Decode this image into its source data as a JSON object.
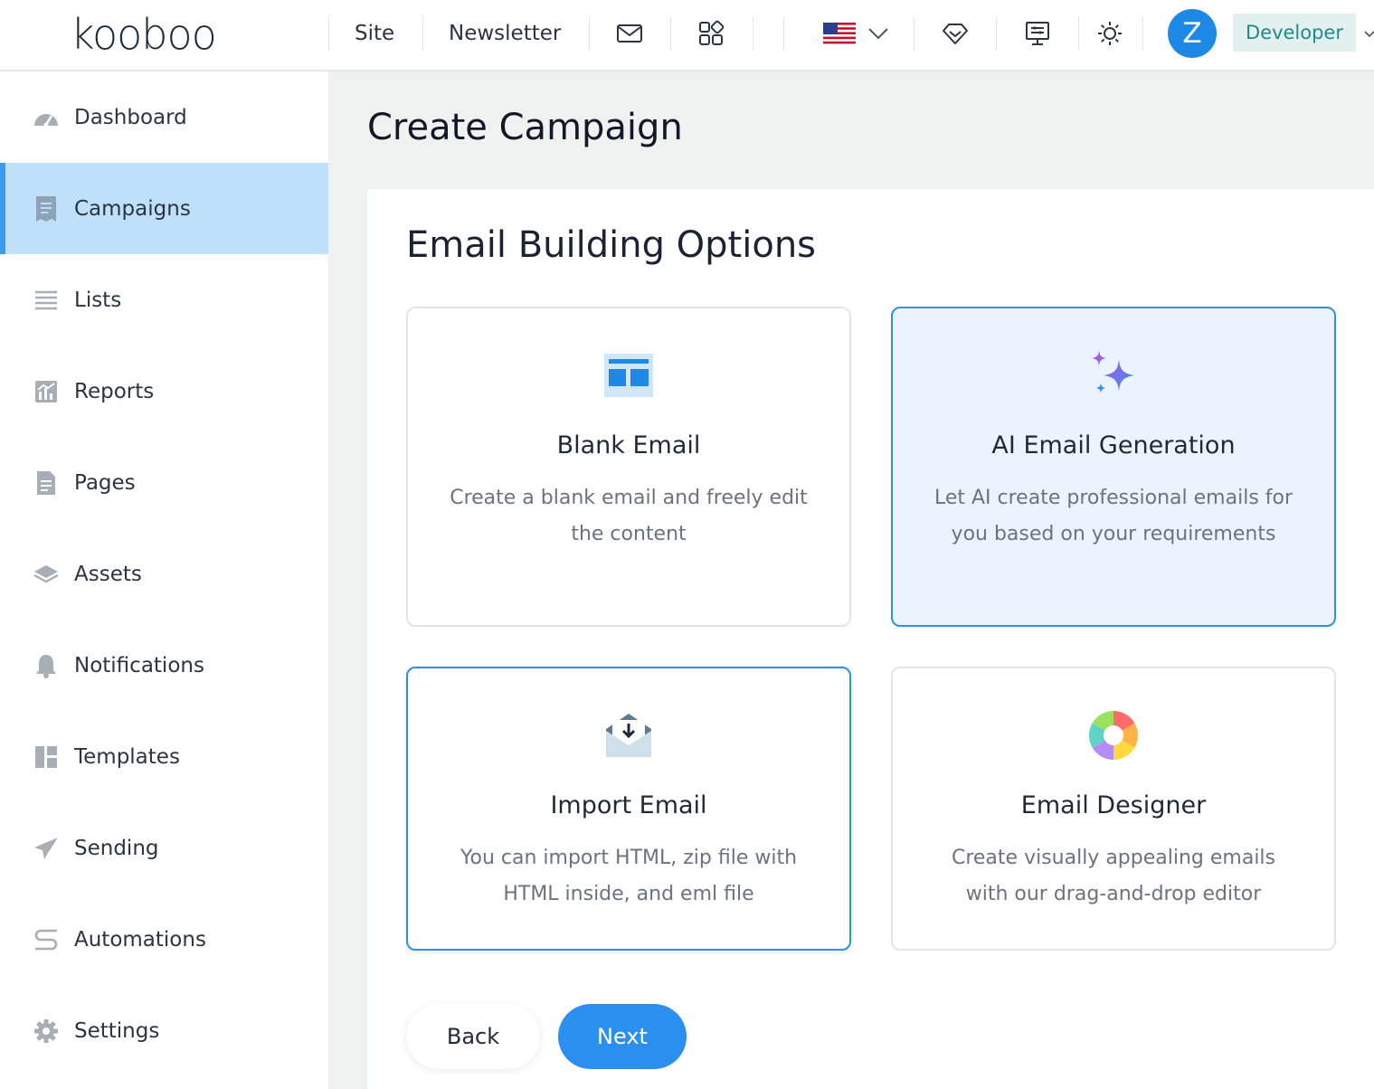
{
  "brand": {
    "logo_text": "kooboo"
  },
  "topnav": {
    "links": [
      {
        "label": "Site"
      },
      {
        "label": "Newsletter"
      }
    ],
    "icons": [
      "mail-icon",
      "apps-grid-icon",
      "us-flag-icon",
      "chevron-down-icon",
      "diamond-icon",
      "monitor-icon",
      "sun-icon"
    ],
    "avatar_letter": "Z",
    "role_label": "Developer"
  },
  "sidebar": {
    "items": [
      {
        "label": "Dashboard",
        "icon": "speedometer-icon"
      },
      {
        "label": "Campaigns",
        "icon": "receipt-icon",
        "active": true
      },
      {
        "label": "Lists",
        "icon": "list-icon"
      },
      {
        "label": "Reports",
        "icon": "bar-chart-icon"
      },
      {
        "label": "Pages",
        "icon": "file-icon"
      },
      {
        "label": "Assets",
        "icon": "layers-icon"
      },
      {
        "label": "Notifications",
        "icon": "bell-icon"
      },
      {
        "label": "Templates",
        "icon": "layout-icon"
      },
      {
        "label": "Sending",
        "icon": "paper-plane-icon"
      },
      {
        "label": "Automations",
        "icon": "flow-icon"
      },
      {
        "label": "Settings",
        "icon": "gear-icon"
      }
    ]
  },
  "main": {
    "page_title": "Create Campaign",
    "section_title": "Email Building Options",
    "options": [
      {
        "title": "Blank Email",
        "description": "Create a blank email and freely edit the content",
        "icon": "blank-layout-icon"
      },
      {
        "title": "AI Email Generation",
        "description": "Let AI create professional emails for you based on your requirements",
        "icon": "sparkles-icon",
        "selected": true
      },
      {
        "title": "Import Email",
        "description": "You can import HTML, zip file with HTML inside, and eml file",
        "icon": "envelope-download-icon"
      },
      {
        "title": "Email Designer",
        "description": "Create visually appealing emails with our drag-and-drop editor",
        "icon": "color-wheel-icon"
      }
    ],
    "buttons": {
      "back": "Back",
      "next": "Next"
    }
  },
  "colors": {
    "accent": "#2b8ff0",
    "active_nav_bg": "#bfe0fb",
    "selected_card_bg": "#ebf4fe",
    "role_badge_bg": "#e2f0ef",
    "role_badge_text": "#1f8a8c"
  }
}
